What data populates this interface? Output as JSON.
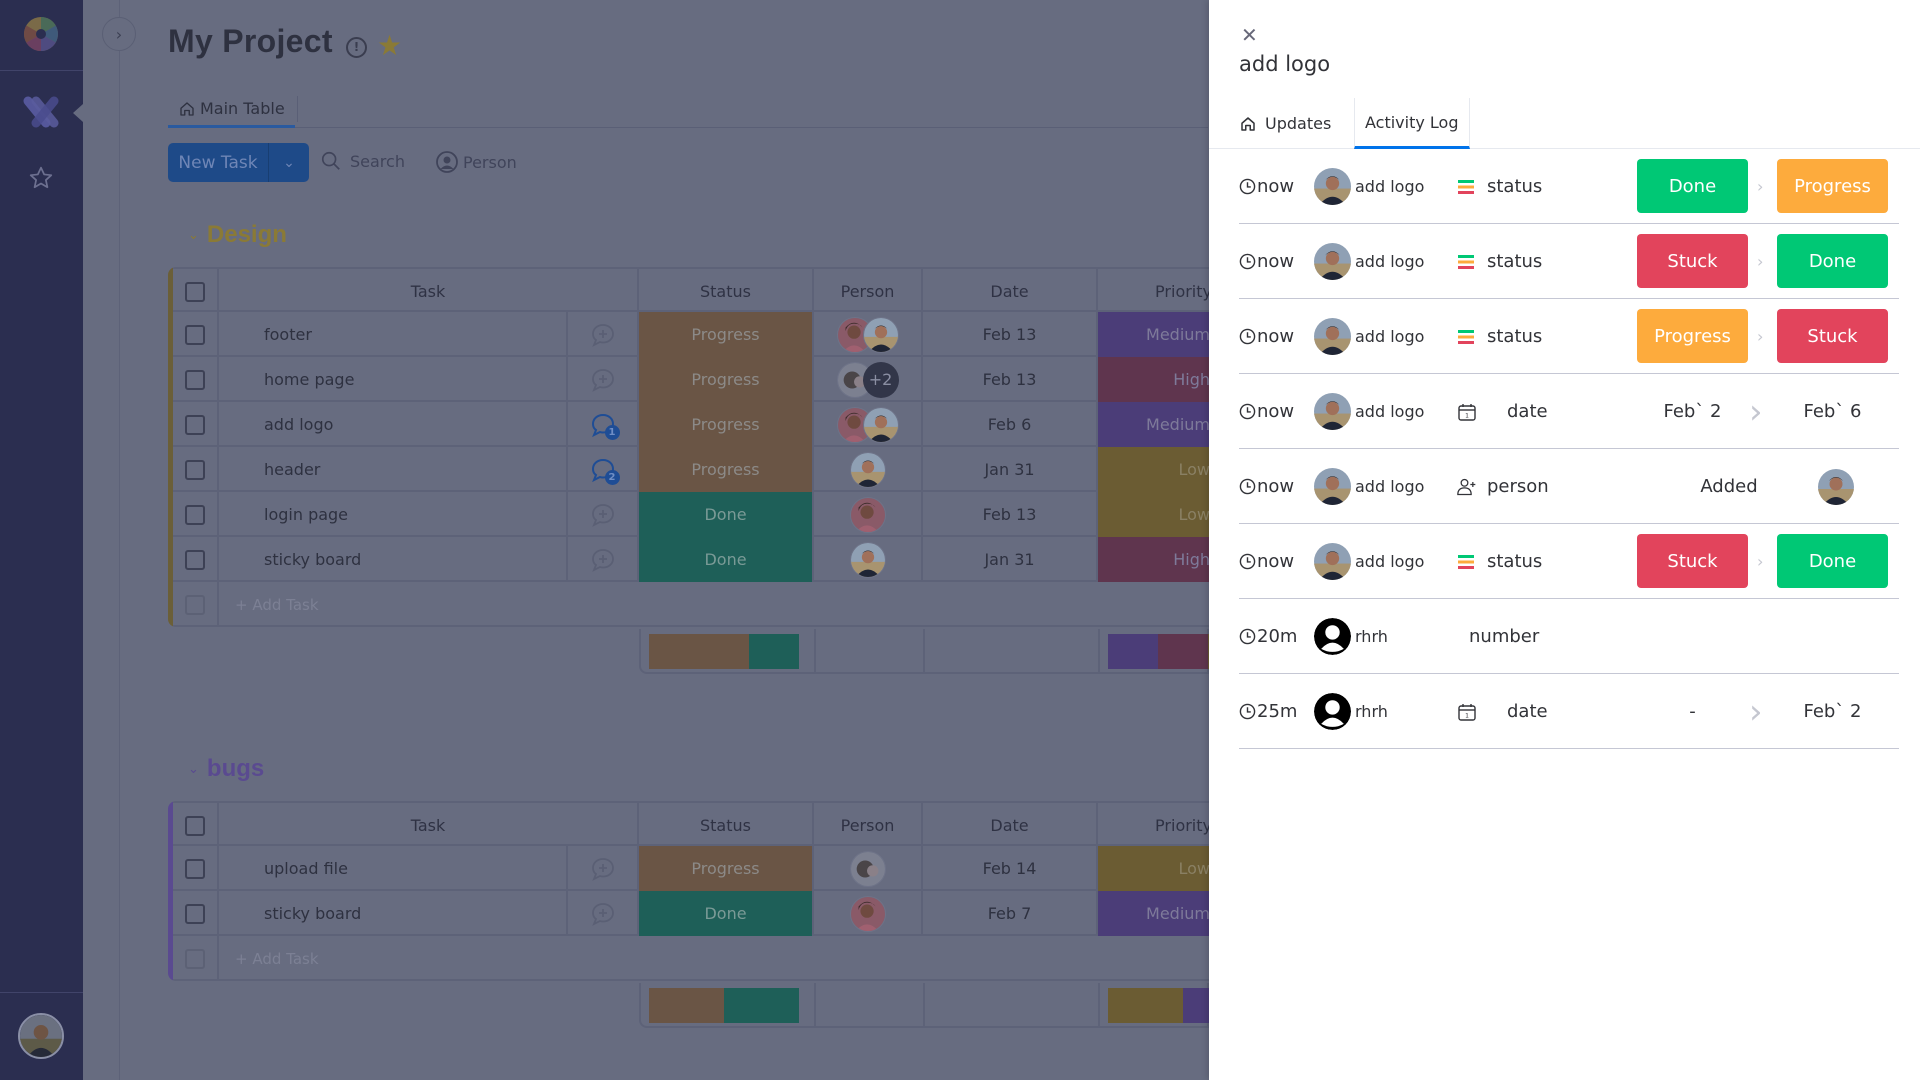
{
  "app": {
    "sidebar": {
      "logo_icon": "monday-logo-icon",
      "items": [
        {
          "name": "work-management",
          "icon": "work-management-icon",
          "active": true
        },
        {
          "name": "favorites",
          "icon": "star-outline-icon",
          "active": false
        }
      ],
      "user_avatar": "user-avatar"
    },
    "collapse_icon": "chevron-right-icon"
  },
  "header": {
    "title": "My Project",
    "info_icon": "info-icon",
    "favorite_icon": "star-filled-icon",
    "tabs": [
      {
        "label": "Main Table",
        "icon": "home-icon",
        "active": true
      }
    ]
  },
  "toolbar": {
    "new_task_label": "New Task",
    "search_label": "Search",
    "person_label": "Person"
  },
  "colors": {
    "done": "#00c875",
    "progress": "#fdab3d",
    "stuck": "#e2445c",
    "medium": "#784bd1",
    "high": "#bb3354",
    "low": "#cab641",
    "accent": "#0073ea",
    "design_group": "#cab641",
    "bugs_group": "#784bd1"
  },
  "columns": [
    "Task",
    "Status",
    "Person",
    "Date",
    "Priority"
  ],
  "groups": [
    {
      "name": "Design",
      "color": "#cab641",
      "rows": [
        {
          "task": "footer",
          "comments": 0,
          "status": "Progress",
          "people": [
            "woman",
            "man"
          ],
          "extra": "",
          "date": "Feb 13",
          "priority": "Medium"
        },
        {
          "task": "home page",
          "comments": 0,
          "status": "Progress",
          "people": [
            "baby"
          ],
          "extra": "+2",
          "date": "Feb 13",
          "priority": "High"
        },
        {
          "task": "add logo",
          "comments": 1,
          "status": "Progress",
          "people": [
            "woman",
            "man"
          ],
          "extra": "",
          "date": "Feb 6",
          "priority": "Medium"
        },
        {
          "task": "header",
          "comments": 2,
          "status": "Progress",
          "people": [
            "man"
          ],
          "extra": "",
          "date": "Jan 31",
          "priority": "Low"
        },
        {
          "task": "login page",
          "comments": 0,
          "status": "Done",
          "people": [
            "woman"
          ],
          "extra": "",
          "date": "Feb 13",
          "priority": "Low"
        },
        {
          "task": "sticky board",
          "comments": 0,
          "status": "Done",
          "people": [
            "man"
          ],
          "extra": "",
          "date": "Jan 31",
          "priority": "High"
        }
      ],
      "add_task_label": "+ Add Task",
      "summary": {
        "status": [
          {
            "label": "Progress",
            "fraction": 0.667
          },
          {
            "label": "Done",
            "fraction": 0.333
          }
        ],
        "priority": [
          {
            "label": "Medium",
            "fraction": 0.333
          },
          {
            "label": "High",
            "fraction": 0.333
          },
          {
            "label": "Low",
            "fraction": 0.333
          }
        ]
      }
    },
    {
      "name": "bugs",
      "color": "#784bd1",
      "rows": [
        {
          "task": "upload file",
          "comments": 0,
          "status": "Progress",
          "people": [
            "baby"
          ],
          "extra": "",
          "date": "Feb 14",
          "priority": "Low"
        },
        {
          "task": "sticky board",
          "comments": 0,
          "status": "Done",
          "people": [
            "woman"
          ],
          "extra": "",
          "date": "Feb 7",
          "priority": "Medium"
        }
      ],
      "add_task_label": "+ Add Task",
      "summary": {
        "status": [
          {
            "label": "Progress",
            "fraction": 0.5
          },
          {
            "label": "Done",
            "fraction": 0.5
          }
        ],
        "priority": [
          {
            "label": "Low",
            "fraction": 0.5
          },
          {
            "label": "Medium",
            "fraction": 0.5
          }
        ]
      }
    }
  ],
  "panel": {
    "title": "add logo",
    "close_icon": "close-icon",
    "tabs": [
      {
        "label": "Updates",
        "icon": "home-icon",
        "active": false
      },
      {
        "label": "Activity Log",
        "active": true
      }
    ],
    "activity": [
      {
        "time": "now",
        "user": "add logo",
        "avatar": "man",
        "column": "status",
        "column_icon": "status-icon",
        "type": "status",
        "from": "Done",
        "to": "Progress"
      },
      {
        "time": "now",
        "user": "add logo",
        "avatar": "man",
        "column": "status",
        "column_icon": "status-icon",
        "type": "status",
        "from": "Stuck",
        "to": "Done"
      },
      {
        "time": "now",
        "user": "add logo",
        "avatar": "man",
        "column": "status",
        "column_icon": "status-icon",
        "type": "status",
        "from": "Progress",
        "to": "Stuck"
      },
      {
        "time": "now",
        "user": "add logo",
        "avatar": "man",
        "column": "date",
        "column_icon": "calendar-icon",
        "type": "date",
        "from": "Feb` 2",
        "to": "Feb` 6"
      },
      {
        "time": "now",
        "user": "add logo",
        "avatar": "man",
        "column": "person",
        "column_icon": "add-person-icon",
        "type": "person",
        "from": "Added",
        "to": "man"
      },
      {
        "time": "now",
        "user": "add logo",
        "avatar": "man",
        "column": "status",
        "column_icon": "status-icon",
        "type": "status",
        "from": "Stuck",
        "to": "Done"
      },
      {
        "time": "20m",
        "user": "rhrh",
        "avatar": "default",
        "column": "number",
        "column_icon": "",
        "type": "number",
        "from": "",
        "to": ""
      },
      {
        "time": "25m",
        "user": "rhrh",
        "avatar": "default",
        "column": "date",
        "column_icon": "calendar-icon",
        "type": "date",
        "from": "-",
        "to": "Feb` 2"
      }
    ]
  }
}
